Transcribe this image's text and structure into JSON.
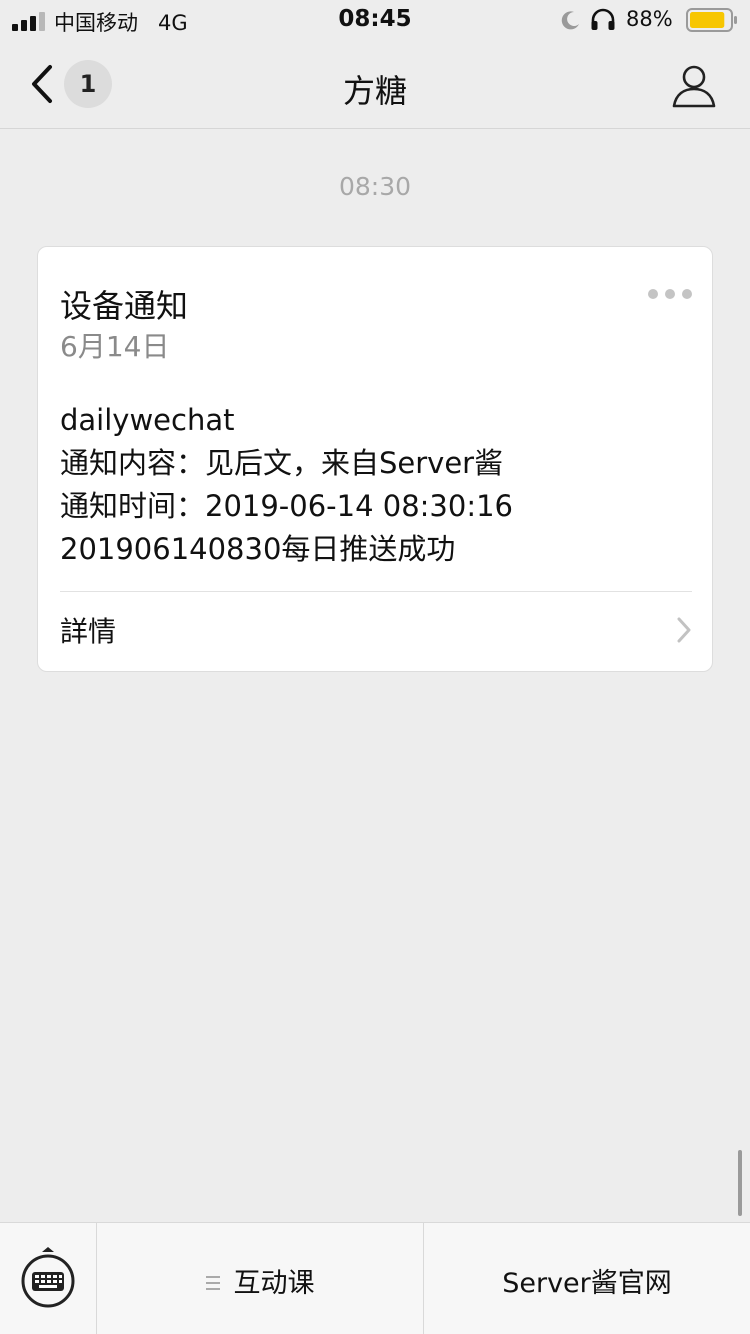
{
  "status_bar": {
    "carrier": "中国移动",
    "network": "4G",
    "time": "08:45",
    "battery_percent": "88%",
    "battery_level": 0.88,
    "battery_color": "#f7c600"
  },
  "nav": {
    "back_icon": "chevron-left-icon",
    "unread_count": "1",
    "title": "方糖",
    "profile_icon": "person-icon"
  },
  "chat": {
    "timestamp": "08:30",
    "card": {
      "title": "设备通知",
      "date": "6月14日",
      "more_icon": "ellipsis-icon",
      "lines": [
        "dailywechat",
        "通知内容：见后文，来自Server酱",
        "通知时间：2019-06-14 08:30:16",
        "201906140830每日推送成功"
      ],
      "details_label": "詳情",
      "details_icon": "chevron-right-icon"
    }
  },
  "bottom_menu": {
    "keyboard_icon": "keyboard-icon",
    "items": [
      {
        "label": "互动课",
        "has_submenu": true,
        "icon": "submenu-icon"
      },
      {
        "label": "Server酱官网",
        "has_submenu": false
      }
    ]
  }
}
